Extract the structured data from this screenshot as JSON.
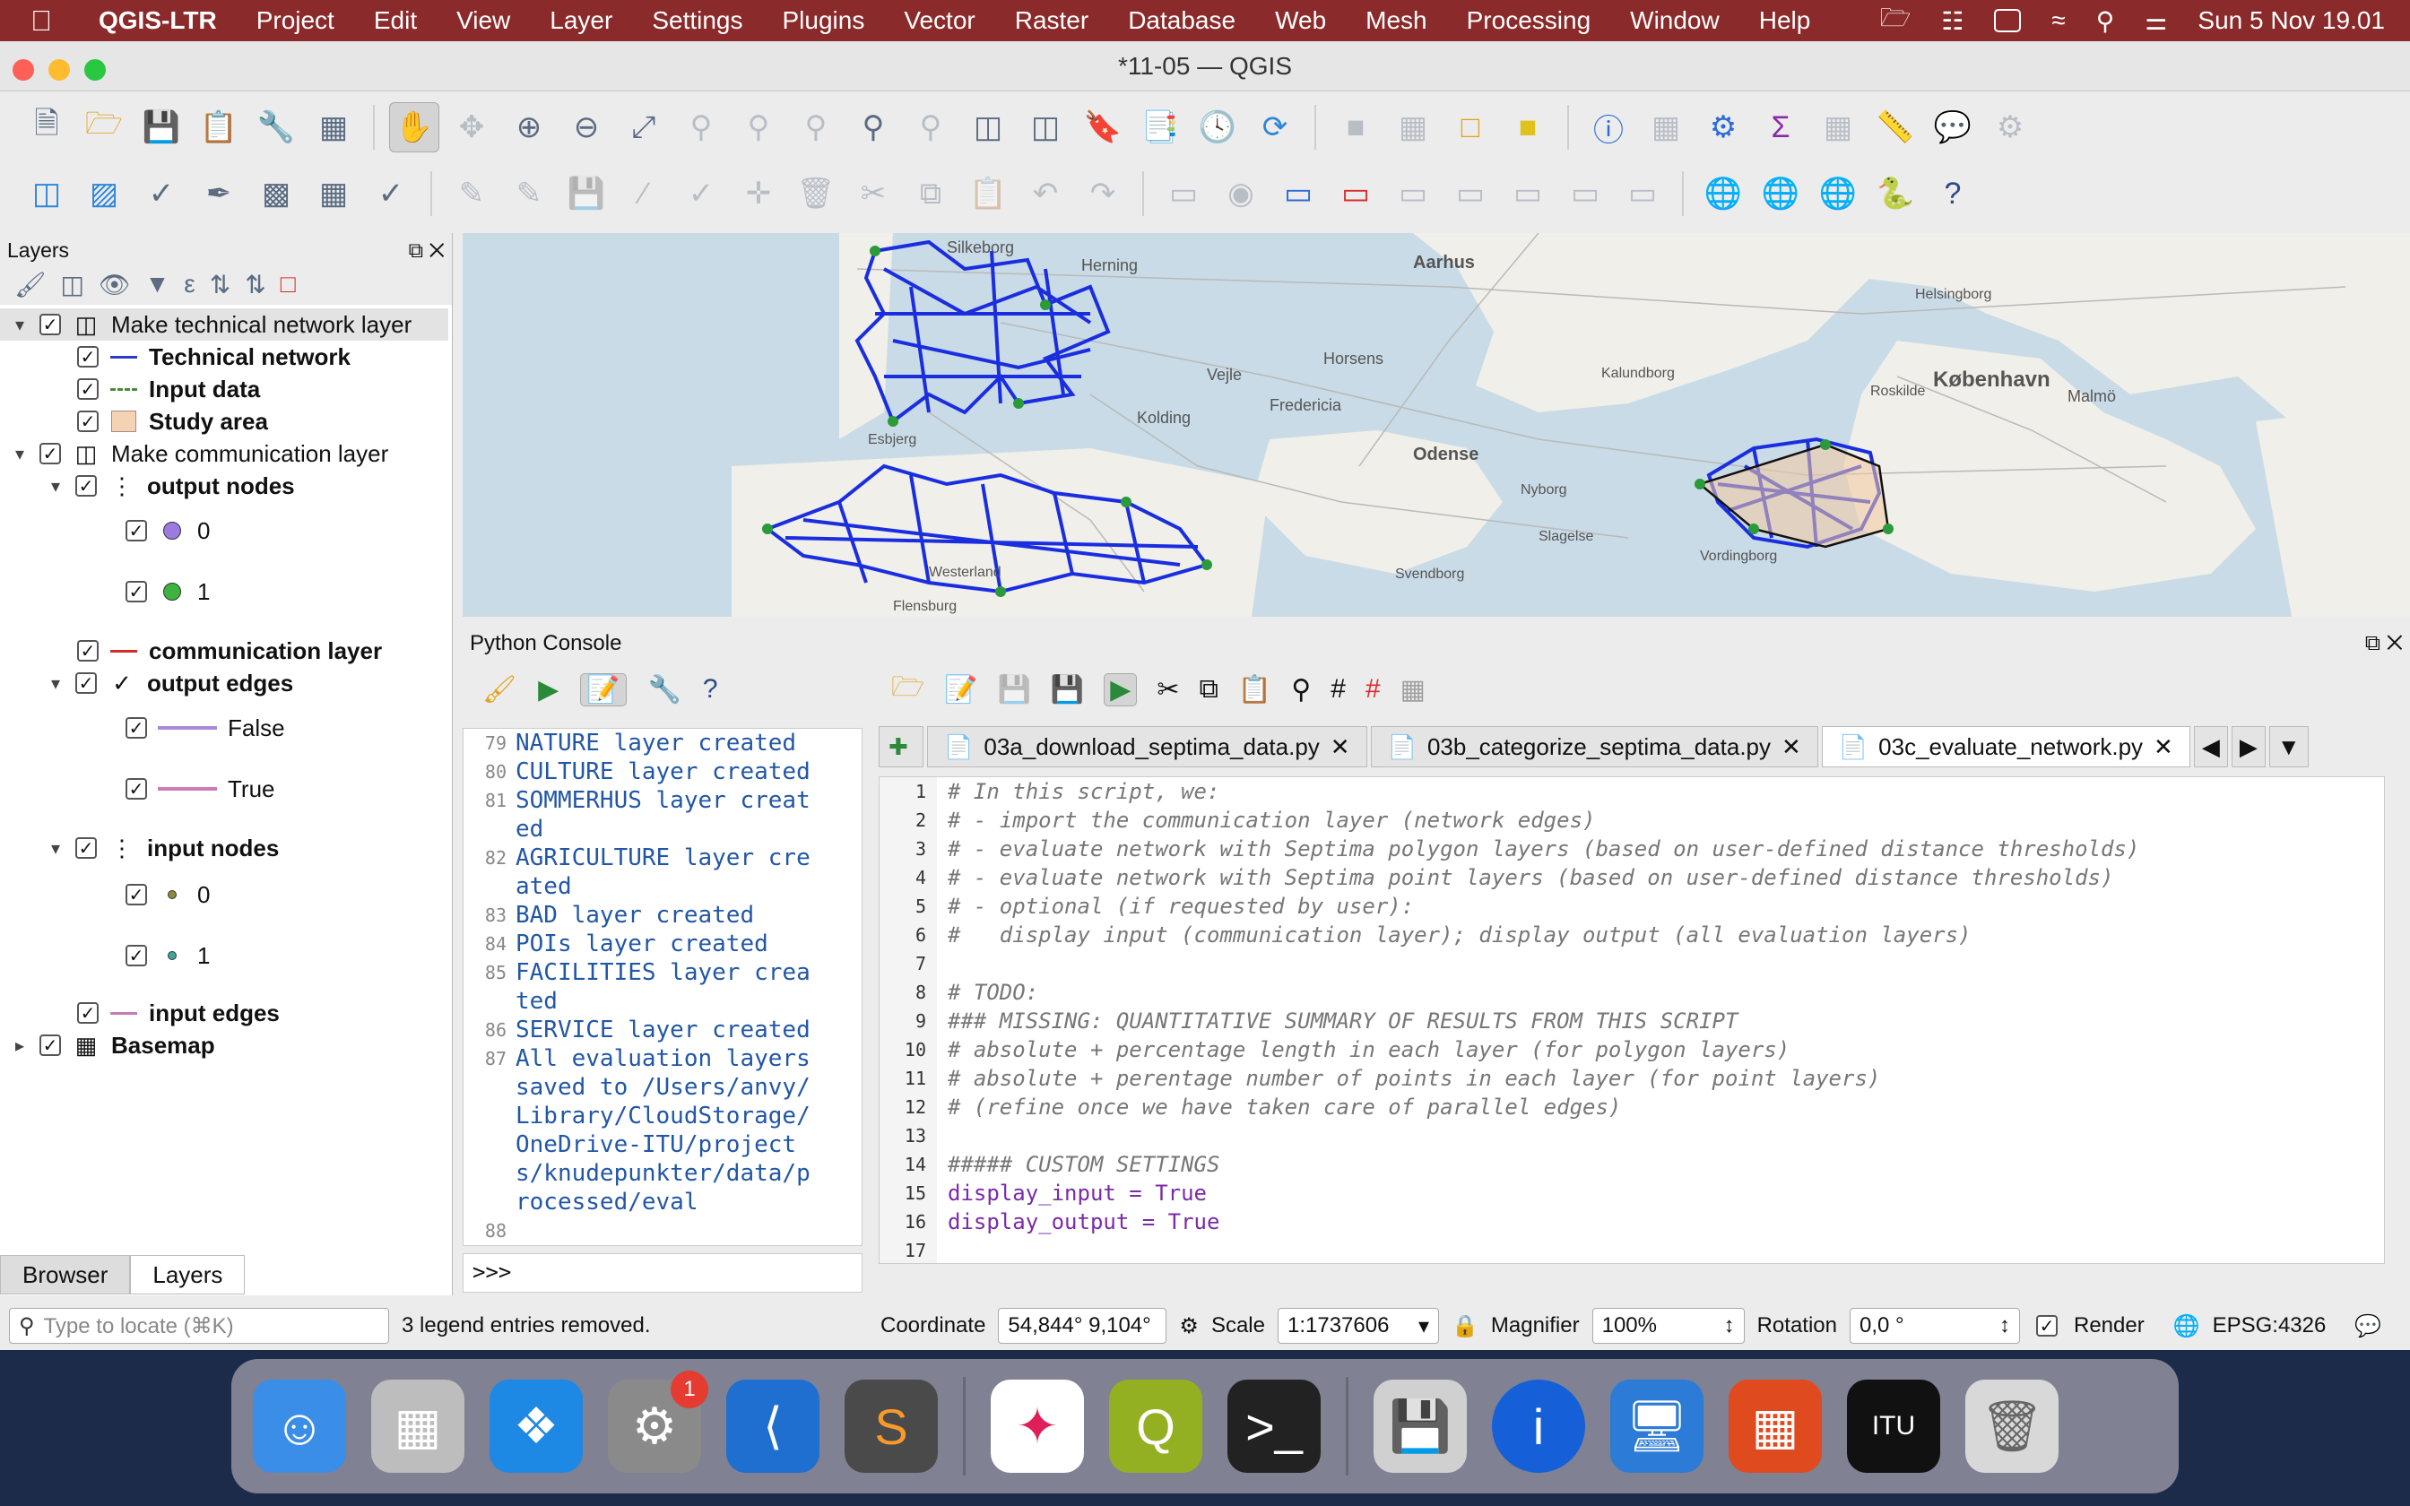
{
  "menubar": {
    "app": "QGIS-LTR",
    "items": [
      "Project",
      "Edit",
      "View",
      "Layer",
      "Settings",
      "Plugins",
      "Vector",
      "Raster",
      "Database",
      "Web",
      "Mesh",
      "Processing",
      "Window",
      "Help"
    ],
    "datetime": "Sun 5 Nov  19.01"
  },
  "window": {
    "title": "*11-05 — QGIS"
  },
  "layers_panel": {
    "title": "Layers",
    "rows": [
      {
        "label": "Make technical network layer"
      },
      {
        "label": "Technical network"
      },
      {
        "label": "Input data"
      },
      {
        "label": "Study area"
      },
      {
        "label": "Make communication layer"
      },
      {
        "label": "output nodes"
      },
      {
        "label": "0"
      },
      {
        "label": "1"
      },
      {
        "label": "communication layer"
      },
      {
        "label": "output edges"
      },
      {
        "label": "False"
      },
      {
        "label": "True"
      },
      {
        "label": "input nodes"
      },
      {
        "label": "0"
      },
      {
        "label": "1"
      },
      {
        "label": "input edges"
      },
      {
        "label": "Basemap"
      }
    ],
    "tabs": [
      "Browser",
      "Layers"
    ]
  },
  "map": {
    "labels": [
      "Silkeborg",
      "Herning",
      "Aarhus",
      "Horsens",
      "Vejle",
      "Kolding",
      "Esbjerg",
      "Fredericia",
      "Odense",
      "Nyborg",
      "Kalundborg",
      "København",
      "Roskilde",
      "Malmö",
      "Svendborg",
      "Flensburg",
      "Westerland",
      "Vordingborg",
      "Helsingborg",
      "Slagelse"
    ]
  },
  "python_console": {
    "title": "Python Console",
    "output": [
      {
        "n": "79",
        "text": "NATURE layer created"
      },
      {
        "n": "80",
        "text": "CULTURE layer created"
      },
      {
        "n": "81",
        "text": "SOMMERHUS layer created"
      },
      {
        "n": "82",
        "text": "AGRICULTURE layer created"
      },
      {
        "n": "83",
        "text": "BAD layer created"
      },
      {
        "n": "84",
        "text": "POIs layer created"
      },
      {
        "n": "85",
        "text": "FACILITIES layer created"
      },
      {
        "n": "86",
        "text": "SERVICE layer created"
      },
      {
        "n": "87",
        "text": "All evaluation layers saved to /Users/anvy/Library/CloudStorage/OneDrive-ITU/projects/knudepunkter/data/processed/eval"
      },
      {
        "n": "88",
        "text": ""
      }
    ],
    "prompt": ">>>"
  },
  "editor": {
    "tabs": [
      "03a_download_septima_data.py",
      "03b_categorize_septima_data.py",
      "03c_evaluate_network.py"
    ],
    "lines": [
      {
        "n": "1",
        "text": "# In this script, we:",
        "kind": "cmt"
      },
      {
        "n": "2",
        "text": "# - import the communication layer (network edges)",
        "kind": "cmt"
      },
      {
        "n": "3",
        "text": "# - evaluate network with Septima polygon layers (based on user-defined distance thresholds)",
        "kind": "cmt"
      },
      {
        "n": "4",
        "text": "# - evaluate network with Septima point layers (based on user-defined distance thresholds)",
        "kind": "cmt"
      },
      {
        "n": "5",
        "text": "# - optional (if requested by user):",
        "kind": "cmt"
      },
      {
        "n": "6",
        "text": "#   display input (communication layer); display output (all evaluation layers)",
        "kind": "cmt"
      },
      {
        "n": "7",
        "text": "",
        "kind": "cmt"
      },
      {
        "n": "8",
        "text": "# TODO:",
        "kind": "cmt"
      },
      {
        "n": "9",
        "text": "### MISSING: QUANTITATIVE SUMMARY OF RESULTS FROM THIS SCRIPT",
        "kind": "cmt"
      },
      {
        "n": "10",
        "text": "# absolute + percentage length in each layer (for polygon layers)",
        "kind": "cmt"
      },
      {
        "n": "11",
        "text": "# absolute + perentage number of points in each layer (for point layers)",
        "kind": "cmt"
      },
      {
        "n": "12",
        "text": "# (refine once we have taken care of parallel edges)",
        "kind": "cmt"
      },
      {
        "n": "13",
        "text": "",
        "kind": "cmt"
      },
      {
        "n": "14",
        "text": "##### CUSTOM SETTINGS",
        "kind": "cmt"
      },
      {
        "n": "15",
        "text": "display_input = True",
        "kind": "code"
      },
      {
        "n": "16",
        "text": "display_output = True",
        "kind": "code"
      },
      {
        "n": "17",
        "text": "",
        "kind": "code"
      }
    ]
  },
  "statusbar": {
    "locate_placeholder": "Type to locate (⌘K)",
    "message": "3 legend entries removed.",
    "coordinate_label": "Coordinate",
    "coordinate": "54,844° 9,104°",
    "scale_label": "Scale",
    "scale": "1:1737606",
    "magnifier_label": "Magnifier",
    "magnifier": "100%",
    "rotation_label": "Rotation",
    "rotation": "0,0 °",
    "render_label": "Render",
    "crs": "EPSG:4326"
  },
  "dock": {
    "badge": "1"
  }
}
